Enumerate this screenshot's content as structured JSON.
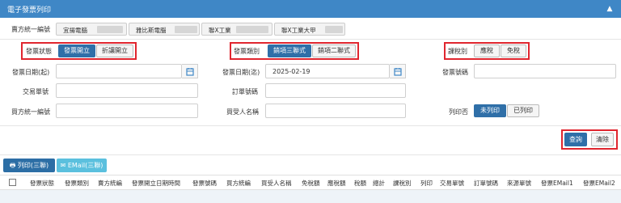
{
  "header": {
    "title": "電子發票列印",
    "collapse_icon": "chevron-up-icon"
  },
  "seller": {
    "label": "賣方統一編號",
    "tabs": [
      "宜揚電腦",
      "雅比斯電腦",
      "聯X工業",
      "聯X工業大甲"
    ]
  },
  "status": {
    "label": "發票狀態",
    "options": [
      "發票開立",
      "折讓開立"
    ],
    "selected": "發票開立"
  },
  "invoice_type": {
    "label": "發票類別",
    "options": [
      "銷項三聯式",
      "銷項二聯式"
    ],
    "selected": "銷項三聯式"
  },
  "tax_type": {
    "label": "課稅別",
    "options": [
      "應稅",
      "免稅"
    ]
  },
  "form": {
    "date_start_label": "發票日期(起)",
    "date_end_label": "發票日期(迄)",
    "date_end_value": "2025-02-19",
    "invoice_no_label": "發票號碼",
    "txn_no_label": "交易單號",
    "order_no_label": "訂單號碼",
    "buyer_tax_label": "買方統一編號",
    "buyer_name_label": "買受人名稱",
    "print_label": "列印否",
    "print_options": [
      "未列印",
      "已列印"
    ],
    "print_selected": "未列印"
  },
  "actions": {
    "query": "查詢",
    "clear": "清除"
  },
  "toolbar": {
    "print": "列印(三聯)",
    "email": "EMail(三聯)"
  },
  "table": {
    "columns": [
      "發票狀態",
      "發票類別",
      "賣方統編",
      "發票開立日期時間",
      "發票號碼",
      "買方統編",
      "買受人名稱",
      "免稅額",
      "應稅額",
      "稅額",
      "總計",
      "課稅別",
      "列印",
      "交易單號",
      "訂單號碼",
      "來源單號",
      "發票EMail1",
      "發票EMail2"
    ]
  },
  "colors": {
    "primary": "#3f87c6",
    "active": "#2f6fa8",
    "highlight": "#e0262f",
    "email_btn": "#5bc0de"
  }
}
